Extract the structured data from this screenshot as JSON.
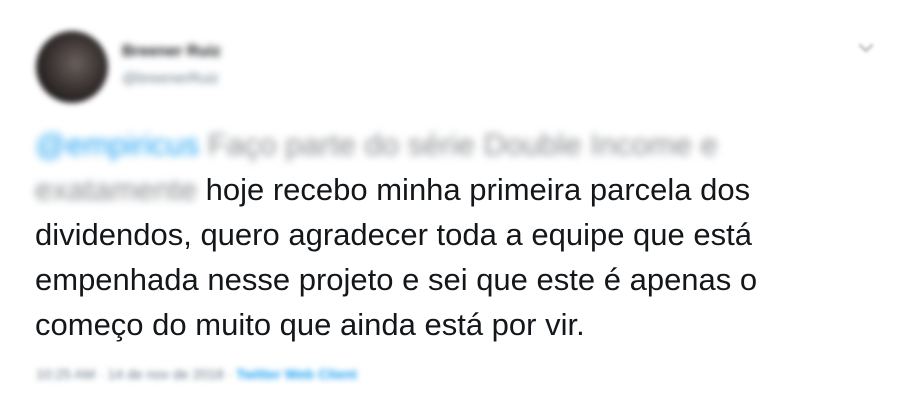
{
  "author": {
    "name": "Breener Ruiz",
    "handle": "@breenerRuiz"
  },
  "tweet": {
    "mention": "@empiricus",
    "line1_rest": " Faço parte do série Double Income e",
    "line2_blurred": "exatamente",
    "line2_clear": " hoje recebo minha primeira parcela dos",
    "line3": "dividendos, quero agradecer toda a equipe que está",
    "line4": "empenhada nesse projeto e sei que este é apenas o",
    "line5": "começo do muito que ainda está por vir."
  },
  "meta": {
    "time": "10:25 AM",
    "separator": " · ",
    "date": "14 de nov de 2018",
    "via": "Twitter Web Client"
  },
  "icons": {
    "more": "chevron-down-icon"
  },
  "colors": {
    "text": "#14171a",
    "link": "#1da1f2",
    "muted": "#657786"
  }
}
